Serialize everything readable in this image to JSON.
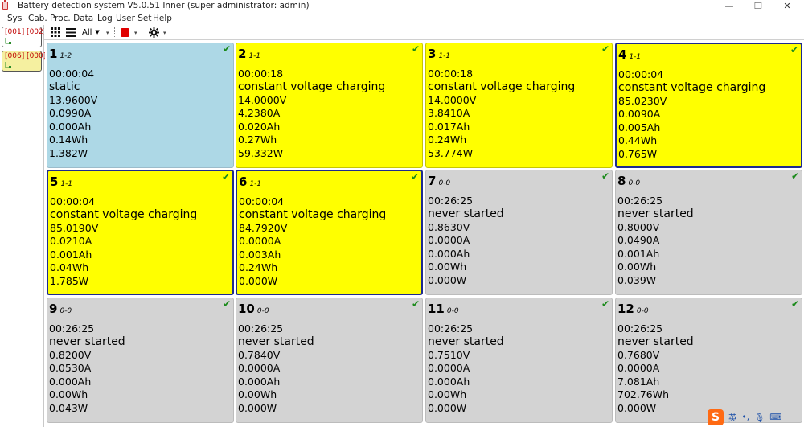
{
  "window": {
    "title": "Battery detection system V5.0.51 Inner (super administrator: admin)",
    "minimize": "—",
    "restore": "❐",
    "close": "✕"
  },
  "menu": [
    "Sys",
    "Cab.",
    "Proc. Data",
    "Log",
    "User Set",
    "Help"
  ],
  "toolbar": {
    "filter_label": "All",
    "dropdown_caret": "▼",
    "small_caret": "▾"
  },
  "cabinets": [
    {
      "label": "[001] [002]",
      "bg": "#ffffff"
    },
    {
      "label": "[006] [000]",
      "bg": "#f5f0a0"
    }
  ],
  "check_mark": "✔",
  "colors": {
    "yellow": "#ffff00",
    "blue": "#add8e6",
    "gray": "#d3d3d3",
    "selected_border": "#1e2b8e",
    "check": "#1a8a1a"
  },
  "channels": [
    {
      "num": "1",
      "sub": "1-2",
      "time": "00:00:04",
      "status": "static",
      "voltage": "13.9600V",
      "current": "0.0990A",
      "capacity": "0.000Ah",
      "energy": "0.14Wh",
      "power": "1.382W",
      "color": "blue",
      "selected": false
    },
    {
      "num": "2",
      "sub": "1-1",
      "time": "00:00:18",
      "status": "constant voltage charging",
      "voltage": "14.0000V",
      "current": "4.2380A",
      "capacity": "0.020Ah",
      "energy": "0.27Wh",
      "power": "59.332W",
      "color": "yellow",
      "selected": false
    },
    {
      "num": "3",
      "sub": "1-1",
      "time": "00:00:18",
      "status": "constant voltage charging",
      "voltage": "14.0000V",
      "current": "3.8410A",
      "capacity": "0.017Ah",
      "energy": "0.24Wh",
      "power": "53.774W",
      "color": "yellow",
      "selected": false
    },
    {
      "num": "4",
      "sub": "1-1",
      "time": "00:00:04",
      "status": "constant voltage charging",
      "voltage": "85.0230V",
      "current": "0.0090A",
      "capacity": "0.005Ah",
      "energy": "0.44Wh",
      "power": "0.765W",
      "color": "yellow",
      "selected": true
    },
    {
      "num": "5",
      "sub": "1-1",
      "time": "00:00:04",
      "status": "constant voltage charging",
      "voltage": "85.0190V",
      "current": "0.0210A",
      "capacity": "0.001Ah",
      "energy": "0.04Wh",
      "power": "1.785W",
      "color": "yellow",
      "selected": true
    },
    {
      "num": "6",
      "sub": "1-1",
      "time": "00:00:04",
      "status": "constant voltage charging",
      "voltage": "84.7920V",
      "current": "0.0000A",
      "capacity": "0.003Ah",
      "energy": "0.24Wh",
      "power": "0.000W",
      "color": "yellow",
      "selected": true
    },
    {
      "num": "7",
      "sub": "0-0",
      "time": "00:26:25",
      "status": "never started",
      "voltage": "0.8630V",
      "current": "0.0000A",
      "capacity": "0.000Ah",
      "energy": "0.00Wh",
      "power": "0.000W",
      "color": "gray",
      "selected": false
    },
    {
      "num": "8",
      "sub": "0-0",
      "time": "00:26:25",
      "status": "never started",
      "voltage": "0.8000V",
      "current": "0.0490A",
      "capacity": "0.001Ah",
      "energy": "0.00Wh",
      "power": "0.039W",
      "color": "gray",
      "selected": false
    },
    {
      "num": "9",
      "sub": "0-0",
      "time": "00:26:25",
      "status": "never started",
      "voltage": "0.8200V",
      "current": "0.0530A",
      "capacity": "0.000Ah",
      "energy": "0.00Wh",
      "power": "0.043W",
      "color": "gray",
      "selected": false
    },
    {
      "num": "10",
      "sub": "0-0",
      "time": "00:26:25",
      "status": "never started",
      "voltage": "0.7840V",
      "current": "0.0000A",
      "capacity": "0.000Ah",
      "energy": "0.00Wh",
      "power": "0.000W",
      "color": "gray",
      "selected": false
    },
    {
      "num": "11",
      "sub": "0-0",
      "time": "00:26:25",
      "status": "never started",
      "voltage": "0.7510V",
      "current": "0.0000A",
      "capacity": "0.000Ah",
      "energy": "0.00Wh",
      "power": "0.000W",
      "color": "gray",
      "selected": false
    },
    {
      "num": "12",
      "sub": "0-0",
      "time": "00:26:25",
      "status": "never started",
      "voltage": "0.7680V",
      "current": "0.0000A",
      "capacity": "7.081Ah",
      "energy": "702.76Wh",
      "power": "0.000W",
      "color": "gray",
      "selected": false
    }
  ],
  "ime": {
    "logo": "S",
    "lang": "英",
    "punct": "•,",
    "mic": "🎙",
    "keyboard": "⌨"
  }
}
